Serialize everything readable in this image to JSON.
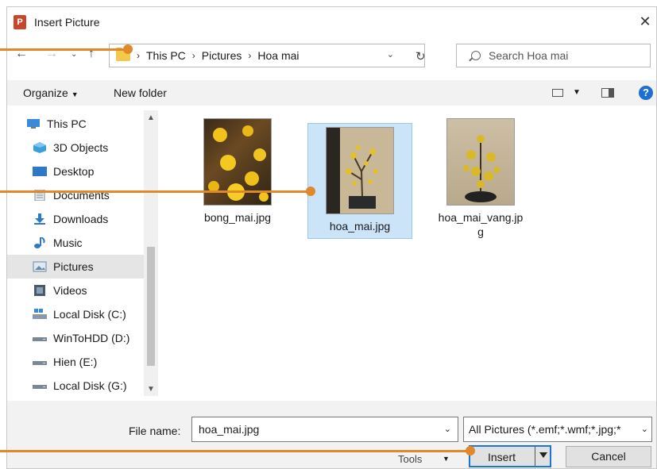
{
  "window": {
    "title": "Insert Picture",
    "app_icon_letter": "P"
  },
  "address": {
    "crumbs": [
      "This PC",
      "Pictures",
      "Hoa mai"
    ]
  },
  "search": {
    "placeholder": "Search Hoa mai"
  },
  "toolbar": {
    "organize_label": "Organize",
    "new_folder_label": "New folder"
  },
  "nav": {
    "items": [
      {
        "label": "This PC",
        "icon": "monitor-icon"
      },
      {
        "label": "3D Objects",
        "icon": "cube-icon"
      },
      {
        "label": "Desktop",
        "icon": "desktop-icon"
      },
      {
        "label": "Documents",
        "icon": "document-icon"
      },
      {
        "label": "Downloads",
        "icon": "download-icon"
      },
      {
        "label": "Music",
        "icon": "music-icon"
      },
      {
        "label": "Pictures",
        "icon": "pictures-icon"
      },
      {
        "label": "Videos",
        "icon": "video-icon"
      },
      {
        "label": "Local Disk (C:)",
        "icon": "drive-icon"
      },
      {
        "label": "WinToHDD (D:)",
        "icon": "drive-icon"
      },
      {
        "label": "Hien (E:)",
        "icon": "drive-icon"
      },
      {
        "label": "Local Disk (G:)",
        "icon": "drive-icon"
      }
    ],
    "selected": "Pictures"
  },
  "files": [
    {
      "name": "bong_mai.jpg"
    },
    {
      "name": "hoa_mai.jpg",
      "selected": true
    },
    {
      "name": "hoa_mai_vang.jp",
      "name_line2": "g"
    }
  ],
  "footer": {
    "file_name_label": "File name:",
    "file_name_value": "hoa_mai.jpg",
    "filter_value": "All Pictures (*.emf;*.wmf;*.jpg;*",
    "tools_label": "Tools",
    "insert_label": "Insert",
    "cancel_label": "Cancel"
  },
  "colors": {
    "accent": "#1b76d6",
    "callout": "#e0892b",
    "selection": "#cce4f7"
  }
}
